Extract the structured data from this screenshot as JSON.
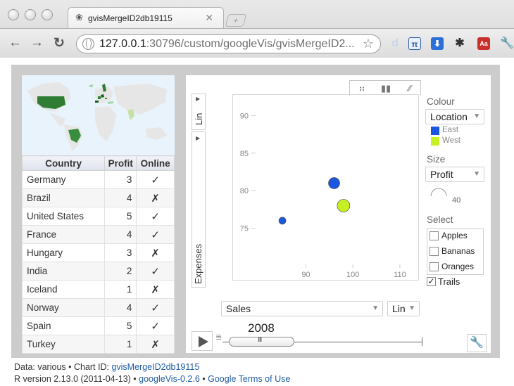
{
  "browser": {
    "tab_title": "gvisMergeID2db19115",
    "address_host": "127.0.0.1",
    "address_rest": ":30796/custom/googleVis/gvisMergeID2...",
    "colors": {
      "chrome": "#dcdcdc"
    }
  },
  "table": {
    "headers": [
      "Country",
      "Profit",
      "Online"
    ],
    "rows": [
      {
        "country": "Germany",
        "profit": "3",
        "online": "✓"
      },
      {
        "country": "Brazil",
        "profit": "4",
        "online": "✗"
      },
      {
        "country": "United States",
        "profit": "5",
        "online": "✓"
      },
      {
        "country": "France",
        "profit": "4",
        "online": "✓"
      },
      {
        "country": "Hungary",
        "profit": "3",
        "online": "✗"
      },
      {
        "country": "India",
        "profit": "2",
        "online": "✓"
      },
      {
        "country": "Iceland",
        "profit": "1",
        "online": "✗"
      },
      {
        "country": "Norway",
        "profit": "4",
        "online": "✓"
      },
      {
        "country": "Spain",
        "profit": "5",
        "online": "✓"
      },
      {
        "country": "Turkey",
        "profit": "1",
        "online": "✗"
      }
    ]
  },
  "motion": {
    "y_scale": "Lin",
    "y_variable": "Expenses",
    "x_variable": "Sales",
    "x_scale": "Lin",
    "year": "2008",
    "colour_label": "Colour",
    "colour_value": "Location",
    "legend": [
      {
        "name": "East",
        "color": "#1a56e0"
      },
      {
        "name": "West",
        "color": "#c6f024"
      }
    ],
    "size_label": "Size",
    "size_value": "Profit",
    "size_number": "40",
    "select_label": "Select",
    "select_items": [
      "Apples",
      "Bananas",
      "Oranges"
    ],
    "trails_label": "Trails",
    "trails_checked": "✓"
  },
  "chart_data": {
    "type": "scatter",
    "x": {
      "ticks": [
        "90",
        "100",
        "110"
      ],
      "range": [
        79,
        113
      ]
    },
    "y": {
      "ticks": [
        "75",
        "80",
        "85",
        "90"
      ],
      "range": [
        70,
        92
      ]
    },
    "points": [
      {
        "x": 85,
        "y": 76,
        "r": 5,
        "color": "#1a56e0"
      },
      {
        "x": 96,
        "y": 81,
        "r": 8,
        "color": "#1a56e0"
      },
      {
        "x": 98,
        "y": 78,
        "r": 9,
        "color": "#c6f024"
      }
    ]
  },
  "footer": {
    "line1_prefix": "Data: various • Chart ID: ",
    "chart_id": "gvisMergeID2db19115",
    "line2_prefix": "R version 2.13.0 (2011-04-13) • ",
    "googlevis": "googleVis-0.2.6",
    "sep": " • ",
    "terms": "Google Terms of Use"
  }
}
